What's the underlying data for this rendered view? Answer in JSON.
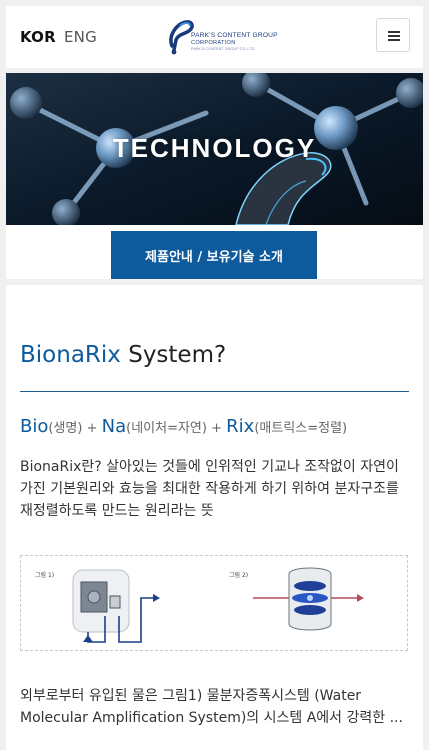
{
  "header": {
    "lang_kor": "KOR",
    "lang_eng": "ENG",
    "logo": {
      "line1": "PARK'S CONTENT GROUP",
      "line2": "CORPORATION",
      "line3": "PARK'S CONTENT GROUP CO.,LTD"
    },
    "menu_icon": "hamburger-icon"
  },
  "hero": {
    "title": "TECHNOLOGY"
  },
  "tabbar": {
    "active_tab": "제품안내 / 보유기술 소개"
  },
  "section": {
    "title_accent": "BionaRix",
    "title_rest": " System?",
    "formula": {
      "bio": "Bio",
      "bio_desc": "(생명)",
      "plus1": " + ",
      "na": "Na",
      "na_desc": "(네이처=자연)",
      "plus2": " + ",
      "rix": "Rix",
      "rix_desc": "(매트릭스=정렬)"
    },
    "description": "BionaRix란? 살아있는 것들에 인위적인 기교나 조작없이 자연이 가진 기본원리와 효능을 최대한 작용하게 하기 위하여 분자구조를 재정렬하도록 만드는 원리라는 뜻",
    "figure1_label": "그림 1)",
    "figure2_label": "그림 2)",
    "paragraph": "외부로부터 유입된 물은 그림1) 물분자증폭시스템 (Water Molecular Amplification System)의 시스템 A에서 강력한 ..."
  },
  "colors": {
    "accent": "#0d5a9c",
    "rule": "#1e5d94",
    "tab_button": "#0d5a9c"
  }
}
